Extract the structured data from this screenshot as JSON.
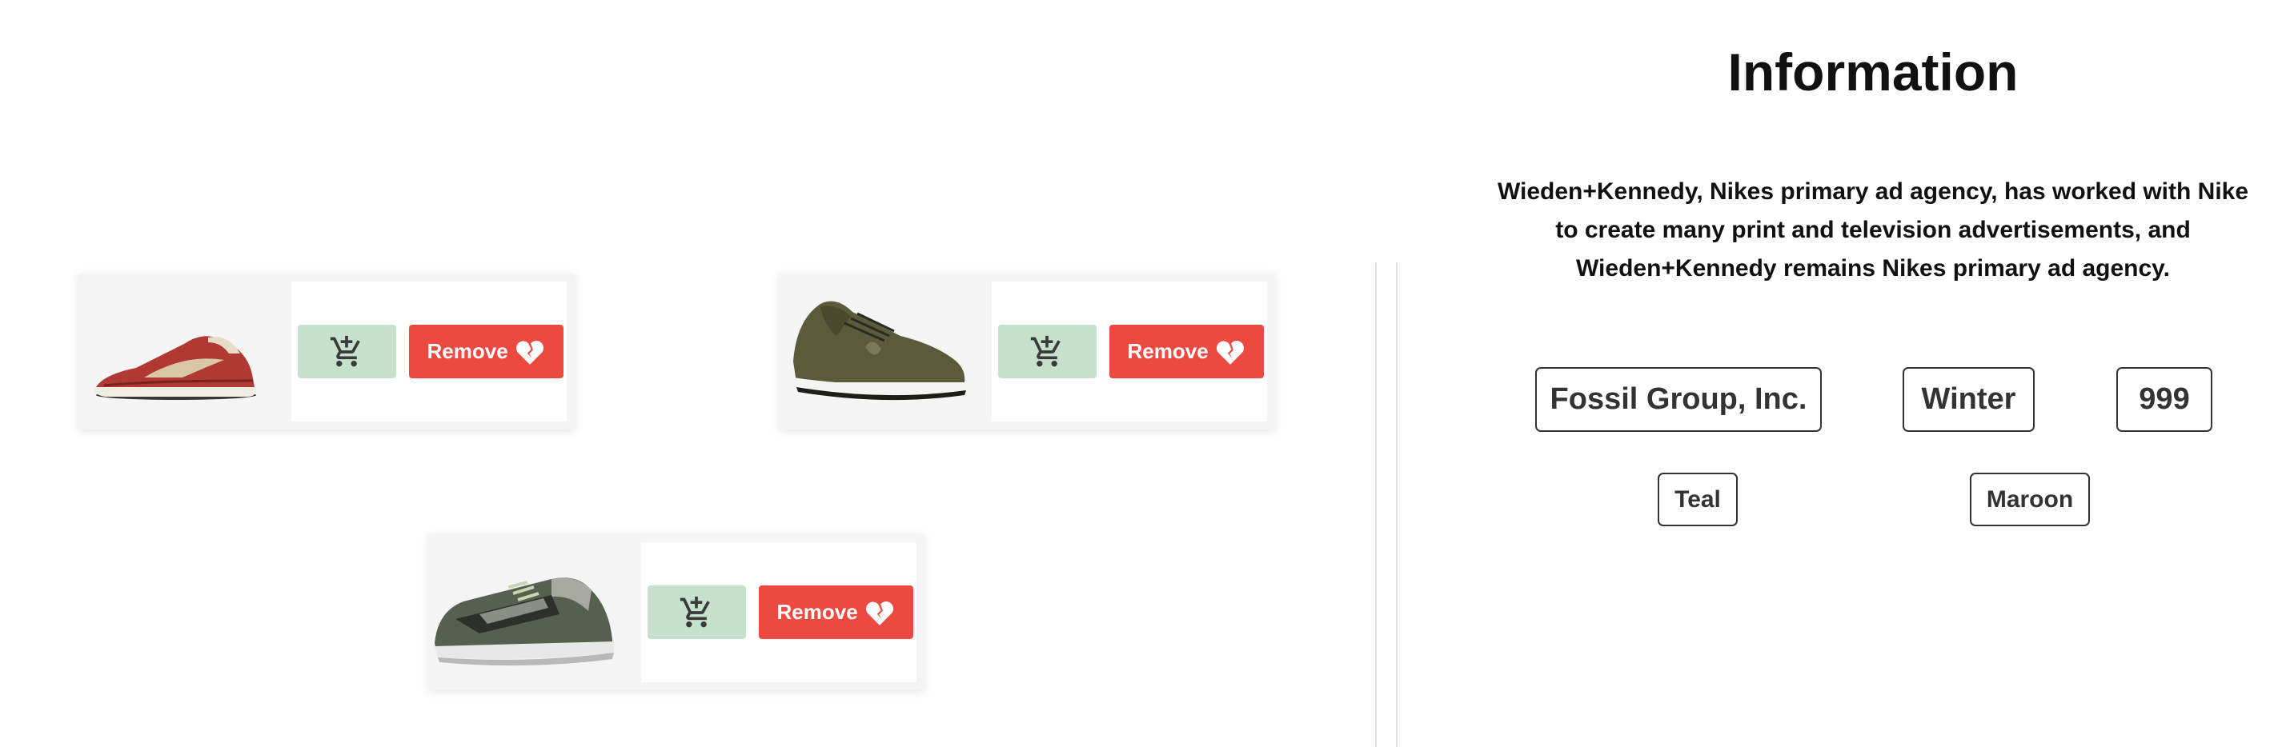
{
  "products": [
    {
      "shoe_icon": "red-running-shoe",
      "colors": {
        "upper": "#b03a33",
        "sole": "#f2ede4",
        "accent": "#d9c7a8"
      },
      "cart_icon": "add-to-cart-icon",
      "remove_label": "Remove",
      "remove_icon": "broken-heart-icon"
    },
    {
      "shoe_icon": "olive-sneaker",
      "colors": {
        "upper": "#5b5a3b",
        "sole": "#f4f4f4",
        "accent": "#2a2a22"
      },
      "cart_icon": "add-to-cart-icon",
      "remove_label": "Remove",
      "remove_icon": "broken-heart-icon"
    },
    {
      "shoe_icon": "grey-green-trainer",
      "colors": {
        "upper": "#55604f",
        "sole": "#e8e8e8",
        "accent": "#a8a9a3"
      },
      "cart_icon": "add-to-cart-icon",
      "remove_label": "Remove",
      "remove_icon": "broken-heart-icon"
    }
  ],
  "info": {
    "title": "Information",
    "description": "Wieden+Kennedy, Nikes primary ad agency, has worked with Nike to create many print and television advertisements, and Wieden+Kennedy remains Nikes primary ad agency.",
    "tags": {
      "brand": "Fossil Group, Inc.",
      "season": "Winter",
      "price": "999",
      "color_1": "Teal",
      "color_2": "Maroon"
    }
  },
  "theme": {
    "cart_button_bg": "#c6e2cd",
    "remove_button_bg": "#ec4a41",
    "card_bg": "#f5f5f5",
    "tag_border": "#333333"
  }
}
